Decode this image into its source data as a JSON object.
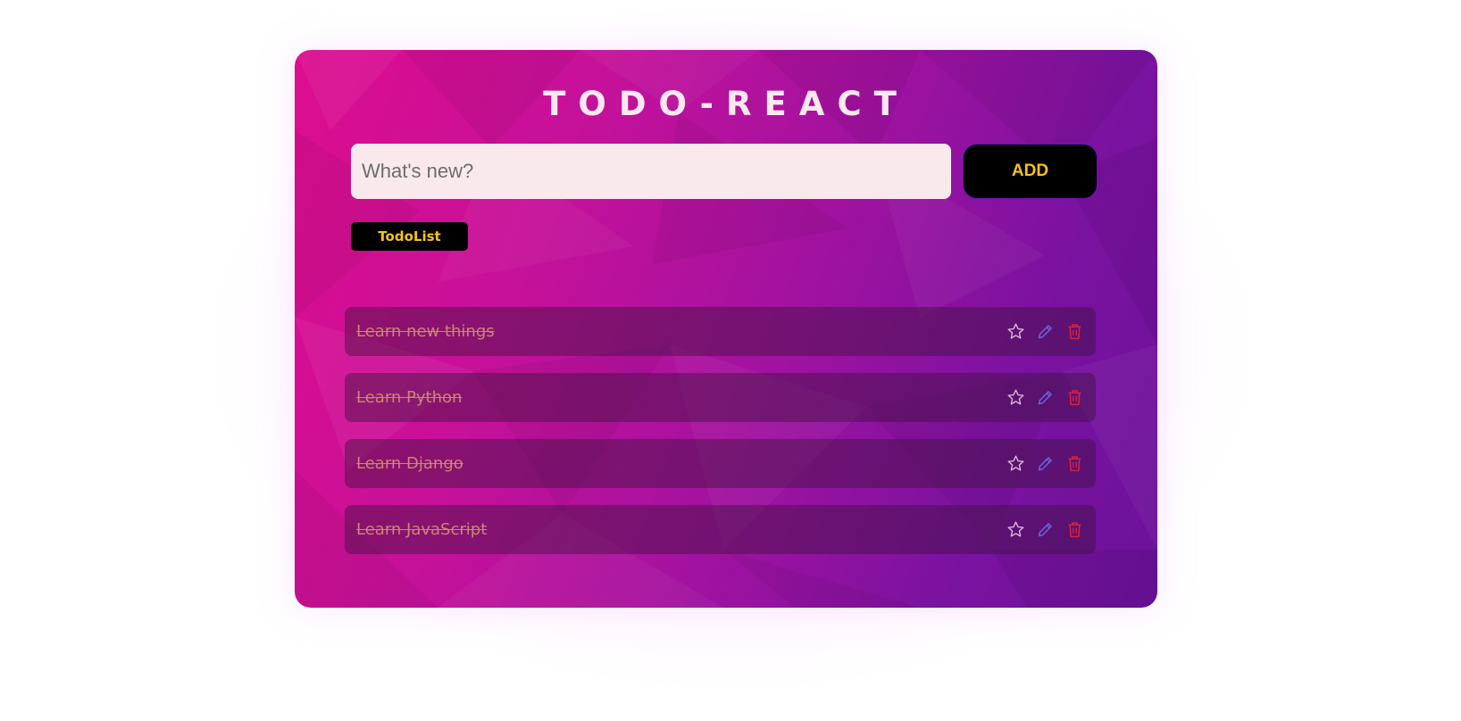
{
  "app": {
    "title": "TODO-REACT"
  },
  "form": {
    "input_placeholder": "What's new?",
    "input_value": "",
    "add_label": "ADD"
  },
  "filter": {
    "label": "TodoList"
  },
  "todos": [
    {
      "text": "Learn new things",
      "completed": true
    },
    {
      "text": "Learn Python",
      "completed": true
    },
    {
      "text": "Learn Django",
      "completed": true
    },
    {
      "text": "Learn JavaScript",
      "completed": true
    }
  ],
  "icons": {
    "favorite": "star-icon",
    "edit": "pencil-icon",
    "delete": "trash-icon"
  },
  "colors": {
    "accent_yellow": "#f6c21b",
    "card_gradient_start": "#dd0d8f",
    "card_gradient_end": "#6b129a",
    "completed_text": "#c98670",
    "star": "#d9b3d9",
    "pencil": "#6a63d8",
    "trash": "#d42340"
  }
}
